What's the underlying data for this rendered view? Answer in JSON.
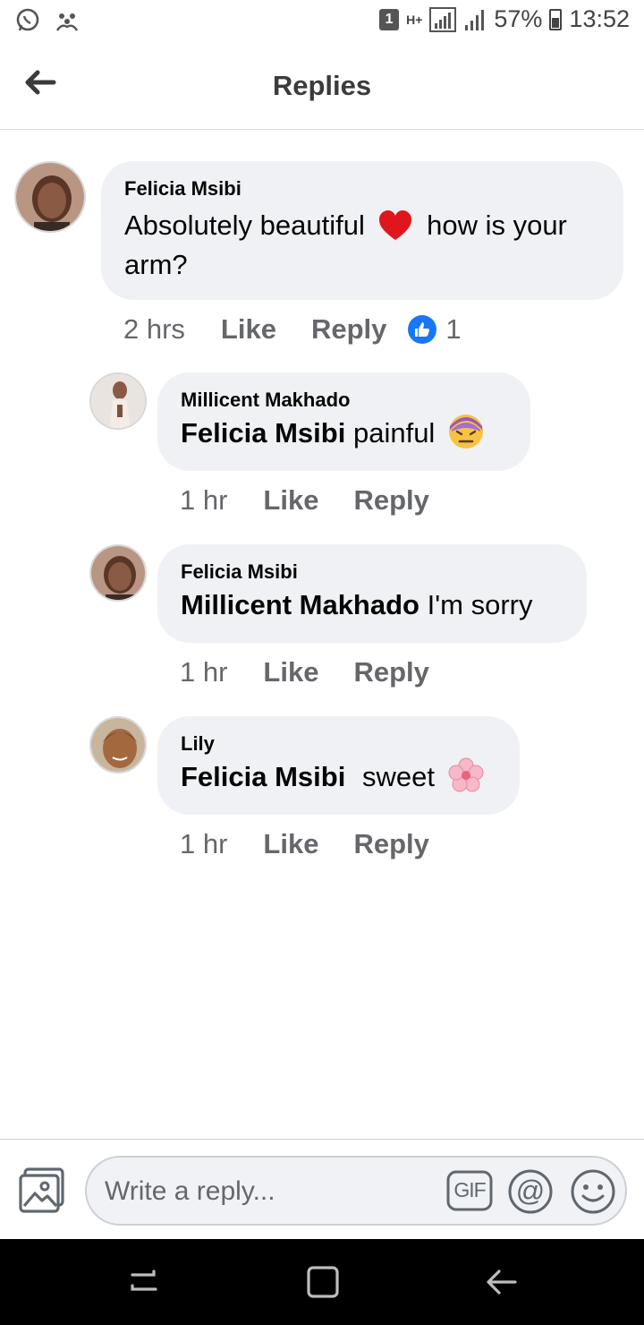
{
  "status_bar": {
    "sim_badge": "1",
    "network": "H+",
    "battery": "57%",
    "time": "13:52"
  },
  "header": {
    "title": "Replies",
    "back_icon": "arrow-left-icon"
  },
  "comments": [
    {
      "author": "Felicia Msibi",
      "text": "Absolutely beautiful",
      "text_after": "how is your arm?",
      "emoji": "red-heart",
      "time": "2 hrs",
      "like_label": "Like",
      "reply_label": "Reply",
      "like_count": "1"
    },
    {
      "author": "Millicent Makhado",
      "mention": "Felicia Msibi",
      "text": "painful",
      "emoji": "face-with-rolling-eyes-purple",
      "time": "1 hr",
      "like_label": "Like",
      "reply_label": "Reply"
    },
    {
      "author": "Felicia Msibi",
      "mention": "Millicent Makhado",
      "text": "I'm sorry",
      "time": "1 hr",
      "like_label": "Like",
      "reply_label": "Reply"
    },
    {
      "author": "Lily",
      "mention": "Felicia Msibi",
      "text": "sweet",
      "emoji": "cherry-blossom",
      "time": "1 hr",
      "like_label": "Like",
      "reply_label": "Reply"
    }
  ],
  "footer": {
    "placeholder": "Write a reply...",
    "gif_label": "GIF",
    "mention_label": "@"
  },
  "colors": {
    "bubble": "#eff1f4",
    "like_blue": "#1877f2",
    "secondary_text": "#65676b"
  }
}
